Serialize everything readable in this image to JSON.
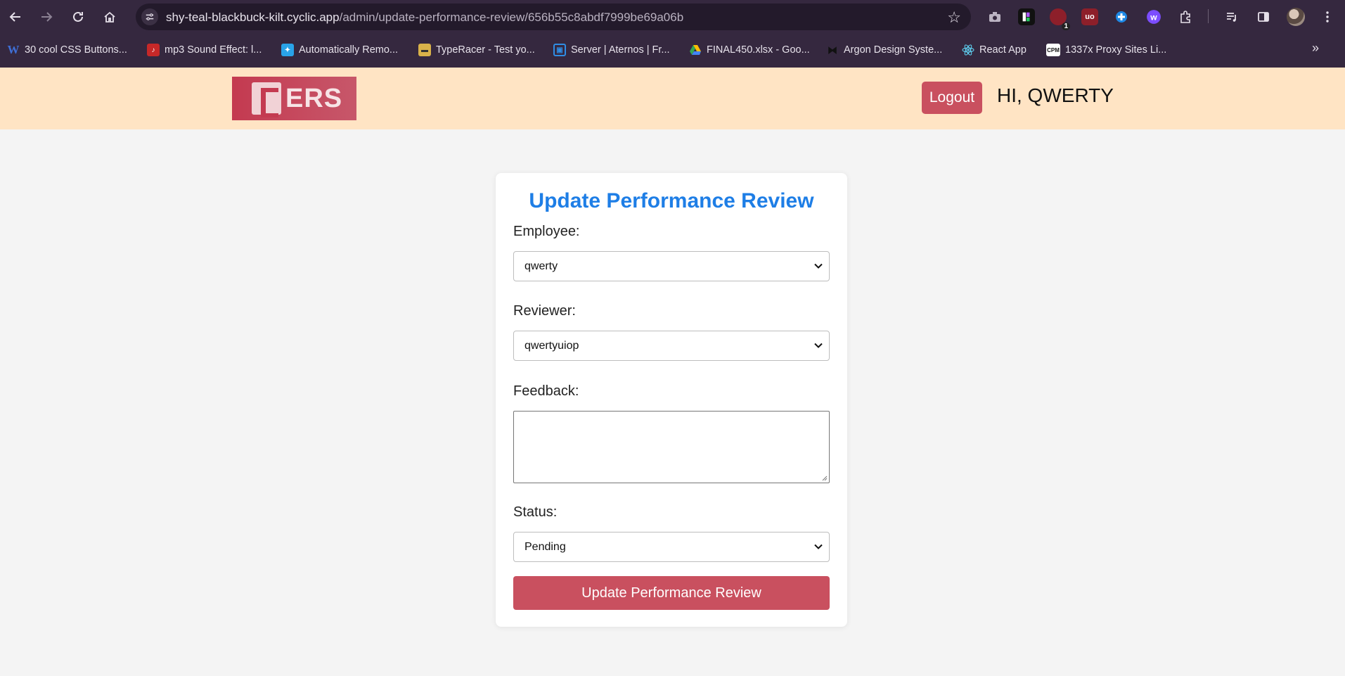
{
  "browser": {
    "url_host": "shy-teal-blackbuck-kilt.cyclic.app",
    "url_path": "/admin/update-performance-review/656b55c8abdf7999be69a06b",
    "extension_badge": "1",
    "bookmarks": [
      {
        "label": "30 cool CSS Buttons...",
        "icon": "w-icon"
      },
      {
        "label": "mp3 Sound Effect: l...",
        "icon": "music-icon"
      },
      {
        "label": "Automatically Remo...",
        "icon": "gear-blue-icon"
      },
      {
        "label": "TypeRacer - Test yo...",
        "icon": "car-icon"
      },
      {
        "label": "Server | Aternos | Fr...",
        "icon": "server-icon"
      },
      {
        "label": "FINAL450.xlsx - Goo...",
        "icon": "drive-icon"
      },
      {
        "label": "Argon Design Syste...",
        "icon": "argon-icon"
      },
      {
        "label": "React App",
        "icon": "react-icon"
      },
      {
        "label": "1337x Proxy Sites Li...",
        "icon": "cpm-icon"
      }
    ]
  },
  "header": {
    "logo_text": "ERS",
    "logout_label": "Logout",
    "greeting": "HI, QWERTY"
  },
  "form": {
    "title": "Update Performance Review",
    "employee_label": "Employee:",
    "employee_value": "qwerty",
    "reviewer_label": "Reviewer:",
    "reviewer_value": "qwertyuiop",
    "feedback_label": "Feedback:",
    "feedback_value": "",
    "status_label": "Status:",
    "status_value": "Pending",
    "submit_label": "Update Performance Review"
  },
  "colors": {
    "header_bg": "#ffe4c4",
    "accent_red": "#c9505f",
    "title_blue": "#1e7ee6"
  }
}
